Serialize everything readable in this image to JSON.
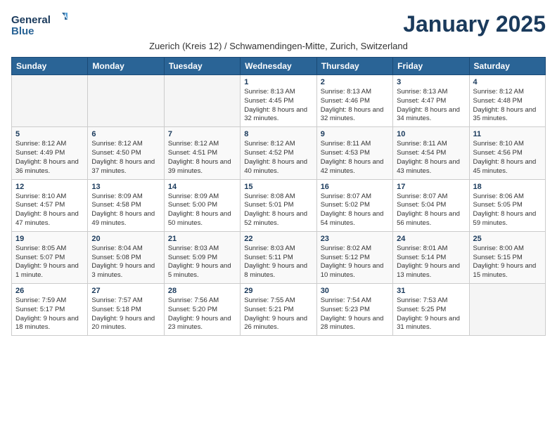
{
  "logo": {
    "line1": "General",
    "line2": "Blue"
  },
  "title": "January 2025",
  "subtitle": "Zuerich (Kreis 12) / Schwamendingen-Mitte, Zurich, Switzerland",
  "weekdays": [
    "Sunday",
    "Monday",
    "Tuesday",
    "Wednesday",
    "Thursday",
    "Friday",
    "Saturday"
  ],
  "weeks": [
    [
      {
        "day": "",
        "detail": ""
      },
      {
        "day": "",
        "detail": ""
      },
      {
        "day": "",
        "detail": ""
      },
      {
        "day": "1",
        "detail": "Sunrise: 8:13 AM\nSunset: 4:45 PM\nDaylight: 8 hours and 32 minutes."
      },
      {
        "day": "2",
        "detail": "Sunrise: 8:13 AM\nSunset: 4:46 PM\nDaylight: 8 hours and 32 minutes."
      },
      {
        "day": "3",
        "detail": "Sunrise: 8:13 AM\nSunset: 4:47 PM\nDaylight: 8 hours and 34 minutes."
      },
      {
        "day": "4",
        "detail": "Sunrise: 8:12 AM\nSunset: 4:48 PM\nDaylight: 8 hours and 35 minutes."
      }
    ],
    [
      {
        "day": "5",
        "detail": "Sunrise: 8:12 AM\nSunset: 4:49 PM\nDaylight: 8 hours and 36 minutes."
      },
      {
        "day": "6",
        "detail": "Sunrise: 8:12 AM\nSunset: 4:50 PM\nDaylight: 8 hours and 37 minutes."
      },
      {
        "day": "7",
        "detail": "Sunrise: 8:12 AM\nSunset: 4:51 PM\nDaylight: 8 hours and 39 minutes."
      },
      {
        "day": "8",
        "detail": "Sunrise: 8:12 AM\nSunset: 4:52 PM\nDaylight: 8 hours and 40 minutes."
      },
      {
        "day": "9",
        "detail": "Sunrise: 8:11 AM\nSunset: 4:53 PM\nDaylight: 8 hours and 42 minutes."
      },
      {
        "day": "10",
        "detail": "Sunrise: 8:11 AM\nSunset: 4:54 PM\nDaylight: 8 hours and 43 minutes."
      },
      {
        "day": "11",
        "detail": "Sunrise: 8:10 AM\nSunset: 4:56 PM\nDaylight: 8 hours and 45 minutes."
      }
    ],
    [
      {
        "day": "12",
        "detail": "Sunrise: 8:10 AM\nSunset: 4:57 PM\nDaylight: 8 hours and 47 minutes."
      },
      {
        "day": "13",
        "detail": "Sunrise: 8:09 AM\nSunset: 4:58 PM\nDaylight: 8 hours and 49 minutes."
      },
      {
        "day": "14",
        "detail": "Sunrise: 8:09 AM\nSunset: 5:00 PM\nDaylight: 8 hours and 50 minutes."
      },
      {
        "day": "15",
        "detail": "Sunrise: 8:08 AM\nSunset: 5:01 PM\nDaylight: 8 hours and 52 minutes."
      },
      {
        "day": "16",
        "detail": "Sunrise: 8:07 AM\nSunset: 5:02 PM\nDaylight: 8 hours and 54 minutes."
      },
      {
        "day": "17",
        "detail": "Sunrise: 8:07 AM\nSunset: 5:04 PM\nDaylight: 8 hours and 56 minutes."
      },
      {
        "day": "18",
        "detail": "Sunrise: 8:06 AM\nSunset: 5:05 PM\nDaylight: 8 hours and 59 minutes."
      }
    ],
    [
      {
        "day": "19",
        "detail": "Sunrise: 8:05 AM\nSunset: 5:07 PM\nDaylight: 9 hours and 1 minute."
      },
      {
        "day": "20",
        "detail": "Sunrise: 8:04 AM\nSunset: 5:08 PM\nDaylight: 9 hours and 3 minutes."
      },
      {
        "day": "21",
        "detail": "Sunrise: 8:03 AM\nSunset: 5:09 PM\nDaylight: 9 hours and 5 minutes."
      },
      {
        "day": "22",
        "detail": "Sunrise: 8:03 AM\nSunset: 5:11 PM\nDaylight: 9 hours and 8 minutes."
      },
      {
        "day": "23",
        "detail": "Sunrise: 8:02 AM\nSunset: 5:12 PM\nDaylight: 9 hours and 10 minutes."
      },
      {
        "day": "24",
        "detail": "Sunrise: 8:01 AM\nSunset: 5:14 PM\nDaylight: 9 hours and 13 minutes."
      },
      {
        "day": "25",
        "detail": "Sunrise: 8:00 AM\nSunset: 5:15 PM\nDaylight: 9 hours and 15 minutes."
      }
    ],
    [
      {
        "day": "26",
        "detail": "Sunrise: 7:59 AM\nSunset: 5:17 PM\nDaylight: 9 hours and 18 minutes."
      },
      {
        "day": "27",
        "detail": "Sunrise: 7:57 AM\nSunset: 5:18 PM\nDaylight: 9 hours and 20 minutes."
      },
      {
        "day": "28",
        "detail": "Sunrise: 7:56 AM\nSunset: 5:20 PM\nDaylight: 9 hours and 23 minutes."
      },
      {
        "day": "29",
        "detail": "Sunrise: 7:55 AM\nSunset: 5:21 PM\nDaylight: 9 hours and 26 minutes."
      },
      {
        "day": "30",
        "detail": "Sunrise: 7:54 AM\nSunset: 5:23 PM\nDaylight: 9 hours and 28 minutes."
      },
      {
        "day": "31",
        "detail": "Sunrise: 7:53 AM\nSunset: 5:25 PM\nDaylight: 9 hours and 31 minutes."
      },
      {
        "day": "",
        "detail": ""
      }
    ]
  ]
}
